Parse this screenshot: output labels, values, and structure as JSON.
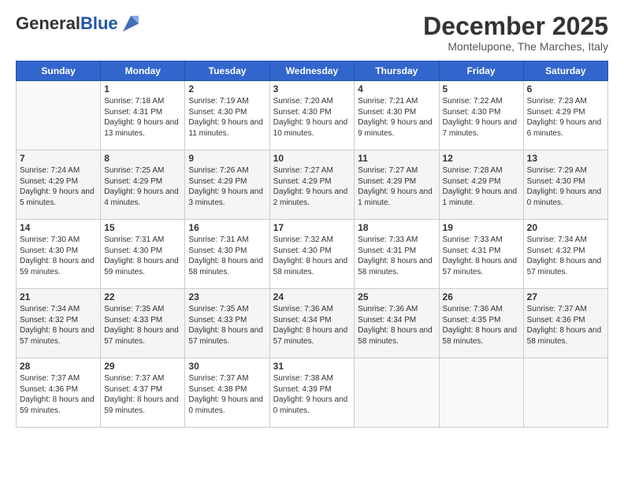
{
  "logo": {
    "general": "General",
    "blue": "Blue"
  },
  "header": {
    "month": "December 2025",
    "location": "Montelupone, The Marches, Italy"
  },
  "weekdays": [
    "Sunday",
    "Monday",
    "Tuesday",
    "Wednesday",
    "Thursday",
    "Friday",
    "Saturday"
  ],
  "weeks": [
    [
      {
        "day": "",
        "sunrise": "",
        "sunset": "",
        "daylight": ""
      },
      {
        "day": "1",
        "sunrise": "Sunrise: 7:18 AM",
        "sunset": "Sunset: 4:31 PM",
        "daylight": "Daylight: 9 hours and 13 minutes."
      },
      {
        "day": "2",
        "sunrise": "Sunrise: 7:19 AM",
        "sunset": "Sunset: 4:30 PM",
        "daylight": "Daylight: 9 hours and 11 minutes."
      },
      {
        "day": "3",
        "sunrise": "Sunrise: 7:20 AM",
        "sunset": "Sunset: 4:30 PM",
        "daylight": "Daylight: 9 hours and 10 minutes."
      },
      {
        "day": "4",
        "sunrise": "Sunrise: 7:21 AM",
        "sunset": "Sunset: 4:30 PM",
        "daylight": "Daylight: 9 hours and 9 minutes."
      },
      {
        "day": "5",
        "sunrise": "Sunrise: 7:22 AM",
        "sunset": "Sunset: 4:30 PM",
        "daylight": "Daylight: 9 hours and 7 minutes."
      },
      {
        "day": "6",
        "sunrise": "Sunrise: 7:23 AM",
        "sunset": "Sunset: 4:29 PM",
        "daylight": "Daylight: 9 hours and 6 minutes."
      }
    ],
    [
      {
        "day": "7",
        "sunrise": "Sunrise: 7:24 AM",
        "sunset": "Sunset: 4:29 PM",
        "daylight": "Daylight: 9 hours and 5 minutes."
      },
      {
        "day": "8",
        "sunrise": "Sunrise: 7:25 AM",
        "sunset": "Sunset: 4:29 PM",
        "daylight": "Daylight: 9 hours and 4 minutes."
      },
      {
        "day": "9",
        "sunrise": "Sunrise: 7:26 AM",
        "sunset": "Sunset: 4:29 PM",
        "daylight": "Daylight: 9 hours and 3 minutes."
      },
      {
        "day": "10",
        "sunrise": "Sunrise: 7:27 AM",
        "sunset": "Sunset: 4:29 PM",
        "daylight": "Daylight: 9 hours and 2 minutes."
      },
      {
        "day": "11",
        "sunrise": "Sunrise: 7:27 AM",
        "sunset": "Sunset: 4:29 PM",
        "daylight": "Daylight: 9 hours and 1 minute."
      },
      {
        "day": "12",
        "sunrise": "Sunrise: 7:28 AM",
        "sunset": "Sunset: 4:29 PM",
        "daylight": "Daylight: 9 hours and 1 minute."
      },
      {
        "day": "13",
        "sunrise": "Sunrise: 7:29 AM",
        "sunset": "Sunset: 4:30 PM",
        "daylight": "Daylight: 9 hours and 0 minutes."
      }
    ],
    [
      {
        "day": "14",
        "sunrise": "Sunrise: 7:30 AM",
        "sunset": "Sunset: 4:30 PM",
        "daylight": "Daylight: 8 hours and 59 minutes."
      },
      {
        "day": "15",
        "sunrise": "Sunrise: 7:31 AM",
        "sunset": "Sunset: 4:30 PM",
        "daylight": "Daylight: 8 hours and 59 minutes."
      },
      {
        "day": "16",
        "sunrise": "Sunrise: 7:31 AM",
        "sunset": "Sunset: 4:30 PM",
        "daylight": "Daylight: 8 hours and 58 minutes."
      },
      {
        "day": "17",
        "sunrise": "Sunrise: 7:32 AM",
        "sunset": "Sunset: 4:30 PM",
        "daylight": "Daylight: 8 hours and 58 minutes."
      },
      {
        "day": "18",
        "sunrise": "Sunrise: 7:33 AM",
        "sunset": "Sunset: 4:31 PM",
        "daylight": "Daylight: 8 hours and 58 minutes."
      },
      {
        "day": "19",
        "sunrise": "Sunrise: 7:33 AM",
        "sunset": "Sunset: 4:31 PM",
        "daylight": "Daylight: 8 hours and 57 minutes."
      },
      {
        "day": "20",
        "sunrise": "Sunrise: 7:34 AM",
        "sunset": "Sunset: 4:32 PM",
        "daylight": "Daylight: 8 hours and 57 minutes."
      }
    ],
    [
      {
        "day": "21",
        "sunrise": "Sunrise: 7:34 AM",
        "sunset": "Sunset: 4:32 PM",
        "daylight": "Daylight: 8 hours and 57 minutes."
      },
      {
        "day": "22",
        "sunrise": "Sunrise: 7:35 AM",
        "sunset": "Sunset: 4:33 PM",
        "daylight": "Daylight: 8 hours and 57 minutes."
      },
      {
        "day": "23",
        "sunrise": "Sunrise: 7:35 AM",
        "sunset": "Sunset: 4:33 PM",
        "daylight": "Daylight: 8 hours and 57 minutes."
      },
      {
        "day": "24",
        "sunrise": "Sunrise: 7:36 AM",
        "sunset": "Sunset: 4:34 PM",
        "daylight": "Daylight: 8 hours and 57 minutes."
      },
      {
        "day": "25",
        "sunrise": "Sunrise: 7:36 AM",
        "sunset": "Sunset: 4:34 PM",
        "daylight": "Daylight: 8 hours and 58 minutes."
      },
      {
        "day": "26",
        "sunrise": "Sunrise: 7:36 AM",
        "sunset": "Sunset: 4:35 PM",
        "daylight": "Daylight: 8 hours and 58 minutes."
      },
      {
        "day": "27",
        "sunrise": "Sunrise: 7:37 AM",
        "sunset": "Sunset: 4:36 PM",
        "daylight": "Daylight: 8 hours and 58 minutes."
      }
    ],
    [
      {
        "day": "28",
        "sunrise": "Sunrise: 7:37 AM",
        "sunset": "Sunset: 4:36 PM",
        "daylight": "Daylight: 8 hours and 59 minutes."
      },
      {
        "day": "29",
        "sunrise": "Sunrise: 7:37 AM",
        "sunset": "Sunset: 4:37 PM",
        "daylight": "Daylight: 8 hours and 59 minutes."
      },
      {
        "day": "30",
        "sunrise": "Sunrise: 7:37 AM",
        "sunset": "Sunset: 4:38 PM",
        "daylight": "Daylight: 9 hours and 0 minutes."
      },
      {
        "day": "31",
        "sunrise": "Sunrise: 7:38 AM",
        "sunset": "Sunset: 4:39 PM",
        "daylight": "Daylight: 9 hours and 0 minutes."
      },
      {
        "day": "",
        "sunrise": "",
        "sunset": "",
        "daylight": ""
      },
      {
        "day": "",
        "sunrise": "",
        "sunset": "",
        "daylight": ""
      },
      {
        "day": "",
        "sunrise": "",
        "sunset": "",
        "daylight": ""
      }
    ]
  ]
}
